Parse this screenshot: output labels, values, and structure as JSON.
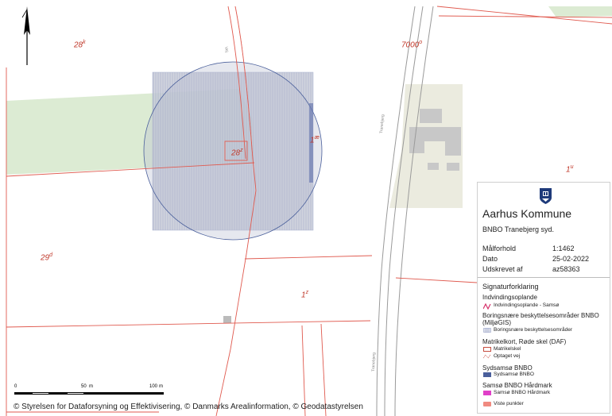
{
  "map": {
    "parcel_labels": [
      {
        "text": "28",
        "sup": "k"
      },
      {
        "text": "7000",
        "sup": "o"
      },
      {
        "text": "28",
        "sup": "z"
      },
      {
        "text": "1",
        "sup": "æ"
      },
      {
        "text": "1",
        "sup": "u"
      },
      {
        "text": "29",
        "sup": "d"
      },
      {
        "text": "1",
        "sup": "z"
      }
    ],
    "road_labels": [
      "Vej",
      "Tranebjerg"
    ]
  },
  "legend": {
    "logo_icon": "aarhus-kommune-crest-icon",
    "title": "Aarhus Kommune",
    "subtitle": "BNBO Tranebjerg syd.",
    "rows": [
      {
        "label": "Målforhold",
        "value": "1:1462"
      },
      {
        "label": "Dato",
        "value": "25-02-2022"
      },
      {
        "label": "Udskrevet af",
        "value": "az58363"
      }
    ],
    "signatur_title": "Signaturforklaring",
    "groups": [
      {
        "title": "Indvindingsoplande",
        "items": [
          {
            "label": "Indvindingsoplande - Samsø",
            "symbol": "red-zigzag",
            "color": "#d6336c"
          }
        ]
      },
      {
        "title": "Boringsnære beskyttelsesområder BNBO (MiljøGIS)",
        "items": [
          {
            "label": "Boringsnære beskyttelsesområder",
            "symbol": "hatched-box",
            "color": "#9aa3c8"
          }
        ]
      },
      {
        "title": "Matrikelkort, Røde skel (DAF)",
        "items": [
          {
            "label": "Matrikelskel",
            "symbol": "red-outline-box",
            "color": "#c0392b"
          },
          {
            "label": "Optaget vej",
            "symbol": "red-dashed",
            "color": "#c0392b"
          }
        ]
      },
      {
        "title": "Sydsamsø BNBO",
        "items": [
          {
            "label": "Sydsamsø BNBO",
            "symbol": "blue-box",
            "color": "#4a5f9b"
          }
        ]
      },
      {
        "title": "Samsø BNBO Hårdmark",
        "items": [
          {
            "label": "Samsø BNBO Hårdmark",
            "symbol": "magenta-box",
            "color": "#e040c8"
          },
          {
            "label": "Viste punkter",
            "symbol": "salmon-box",
            "color": "#f08a80"
          }
        ]
      }
    ]
  },
  "scalebar": {
    "labels": [
      "0",
      "50",
      "m",
      "100",
      "m"
    ]
  },
  "copyright": "© Styrelsen for Dataforsyning og Effektivisering, © Danmarks Arealinformation, © Geodatastyrelsen",
  "colors": {
    "parcel_line": "#e05a4f",
    "field_green": "#dcebd3",
    "bnbo_fill": "#c3c8d6",
    "building": "#c8c8c8",
    "road": "#aaaaaa"
  }
}
